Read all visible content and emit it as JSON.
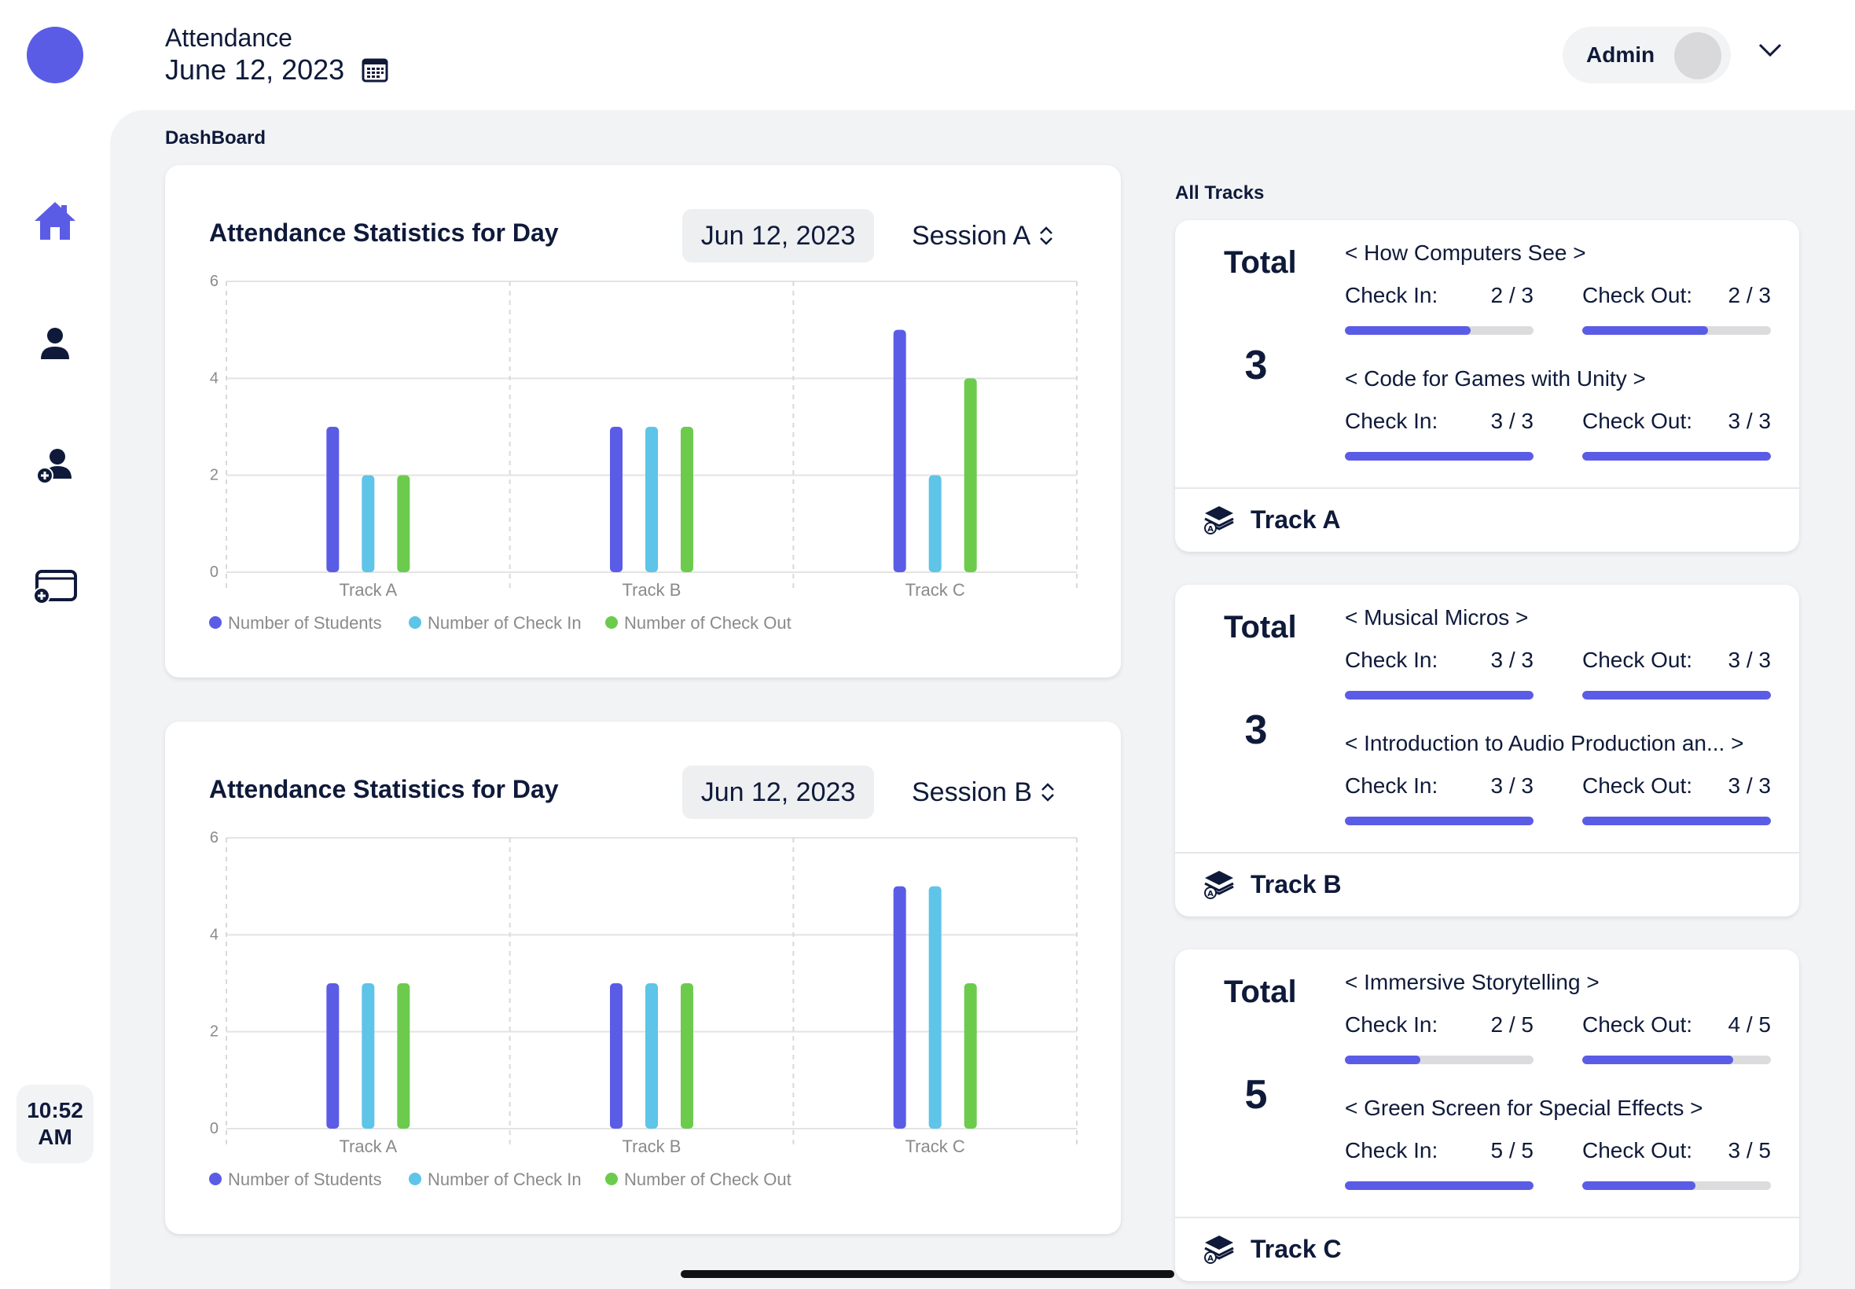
{
  "header": {
    "subtitle": "Attendance",
    "date": "June 12, 2023",
    "user": "Admin"
  },
  "sidebar": {
    "time_line1": "10:52",
    "time_line2": "AM",
    "items": [
      "home-icon",
      "person-icon",
      "add-person-icon",
      "add-window-icon"
    ]
  },
  "dashboard_label": "DashBoard",
  "all_tracks_label": "All Tracks",
  "colors": {
    "primary": "#5b5ce6",
    "students": "#5b5ce6",
    "check_in": "#5ec4e8",
    "check_out": "#6ccb4d"
  },
  "charts": [
    {
      "title": "Attendance Statistics for Day",
      "date": "Jun 12, 2023",
      "session": "Session A"
    },
    {
      "title": "Attendance Statistics for Day",
      "date": "Jun 12, 2023",
      "session": "Session B"
    }
  ],
  "chart_data": [
    {
      "type": "bar",
      "title": "Attendance Statistics for Day",
      "categories": [
        "Track A",
        "Track B",
        "Track C"
      ],
      "ylim": [
        0,
        6
      ],
      "yticks": [
        "0",
        "2",
        "4",
        "6"
      ],
      "series": [
        {
          "name": "Number of Students",
          "values": [
            3,
            3,
            5
          ]
        },
        {
          "name": "Number of Check In",
          "values": [
            2,
            3,
            2
          ]
        },
        {
          "name": "Number of Check Out",
          "values": [
            2,
            3,
            4
          ]
        }
      ],
      "legend": "bottom-left",
      "grid": true
    },
    {
      "type": "bar",
      "title": "Attendance Statistics for Day",
      "categories": [
        "Track A",
        "Track B",
        "Track C"
      ],
      "ylim": [
        0,
        6
      ],
      "yticks": [
        "0",
        "2",
        "4",
        "6"
      ],
      "series": [
        {
          "name": "Number of Students",
          "values": [
            3,
            3,
            5
          ]
        },
        {
          "name": "Number of Check In",
          "values": [
            3,
            3,
            5
          ]
        },
        {
          "name": "Number of Check Out",
          "values": [
            3,
            3,
            3
          ]
        }
      ],
      "legend": "bottom-left",
      "grid": true
    }
  ],
  "tracks": [
    {
      "name": "Track A",
      "total_label": "Total",
      "total": "3",
      "courses": [
        {
          "title": "< How Computers See >",
          "check_in_label": "Check In:",
          "check_in": "2 / 3",
          "check_in_frac": 0.667,
          "check_out_label": "Check Out:",
          "check_out": "2 / 3",
          "check_out_frac": 0.667
        },
        {
          "title": "< Code for Games with Unity >",
          "check_in_label": "Check In:",
          "check_in": "3 / 3",
          "check_in_frac": 1,
          "check_out_label": "Check Out:",
          "check_out": "3 / 3",
          "check_out_frac": 1
        }
      ]
    },
    {
      "name": "Track B",
      "total_label": "Total",
      "total": "3",
      "courses": [
        {
          "title": "< Musical Micros >",
          "check_in_label": "Check In:",
          "check_in": "3 / 3",
          "check_in_frac": 1,
          "check_out_label": "Check Out:",
          "check_out": "3 / 3",
          "check_out_frac": 1
        },
        {
          "title": "< Introduction to Audio Production an... >",
          "check_in_label": "Check In:",
          "check_in": "3 / 3",
          "check_in_frac": 1,
          "check_out_label": "Check Out:",
          "check_out": "3 / 3",
          "check_out_frac": 1
        }
      ]
    },
    {
      "name": "Track C",
      "total_label": "Total",
      "total": "5",
      "courses": [
        {
          "title": "< Immersive Storytelling >",
          "check_in_label": "Check In:",
          "check_in": "2 / 5",
          "check_in_frac": 0.4,
          "check_out_label": "Check Out:",
          "check_out": "4 / 5",
          "check_out_frac": 0.8
        },
        {
          "title": "< Green Screen for Special Effects >",
          "check_in_label": "Check In:",
          "check_in": "5 / 5",
          "check_in_frac": 1,
          "check_out_label": "Check Out:",
          "check_out": "3 / 5",
          "check_out_frac": 0.6
        }
      ]
    }
  ]
}
